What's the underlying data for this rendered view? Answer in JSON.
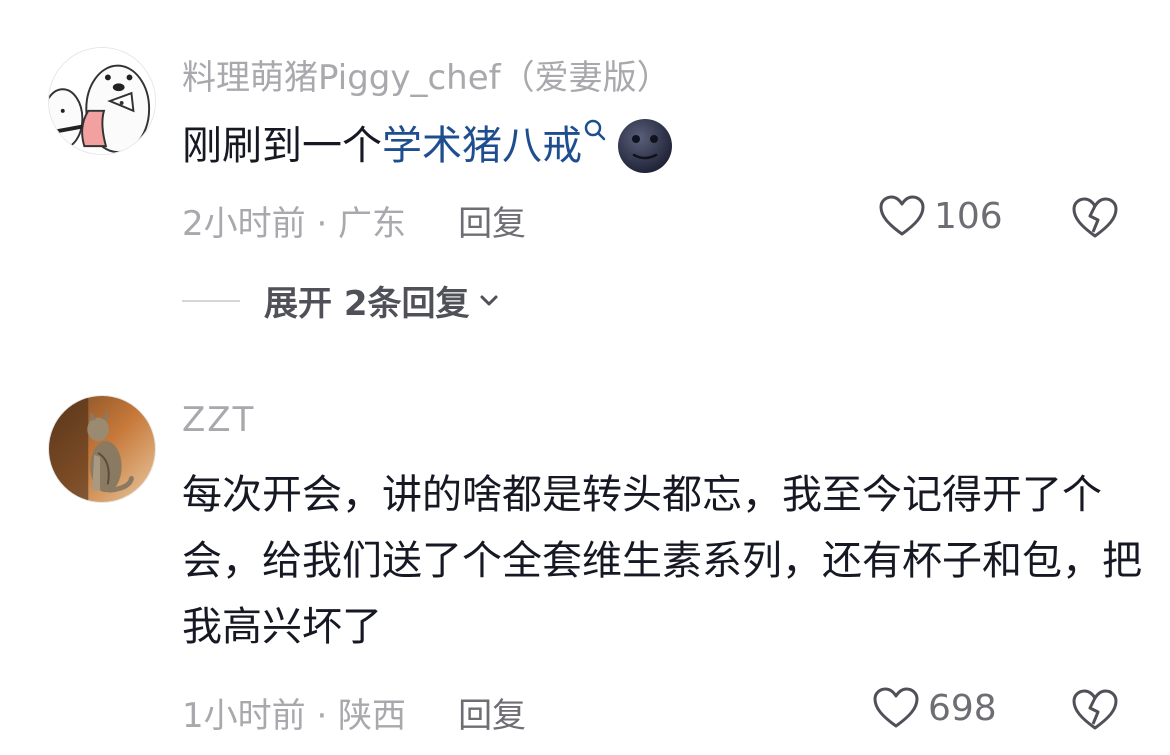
{
  "comments": [
    {
      "username": "料理萌猪Piggy_chef（爱妻版）",
      "text_before": "刚刷到一个",
      "text_link": "学术猪八戒",
      "time_location": "2小时前 · 广东",
      "reply_label": "回复",
      "likes": "106",
      "expand_label": "展开 2条回复"
    },
    {
      "username": "ZZT",
      "text": "每次开会，讲的啥都是转头都忘，我至今记得开了个会，给我们送了个全套维生素系列，还有杯子和包，把我高兴坏了",
      "time_location": "1小时前 · 陕西",
      "reply_label": "回复",
      "likes": "698"
    }
  ],
  "colors": {
    "link": "#1f4e8f",
    "muted": "#a8a8ad",
    "text": "#161823"
  }
}
